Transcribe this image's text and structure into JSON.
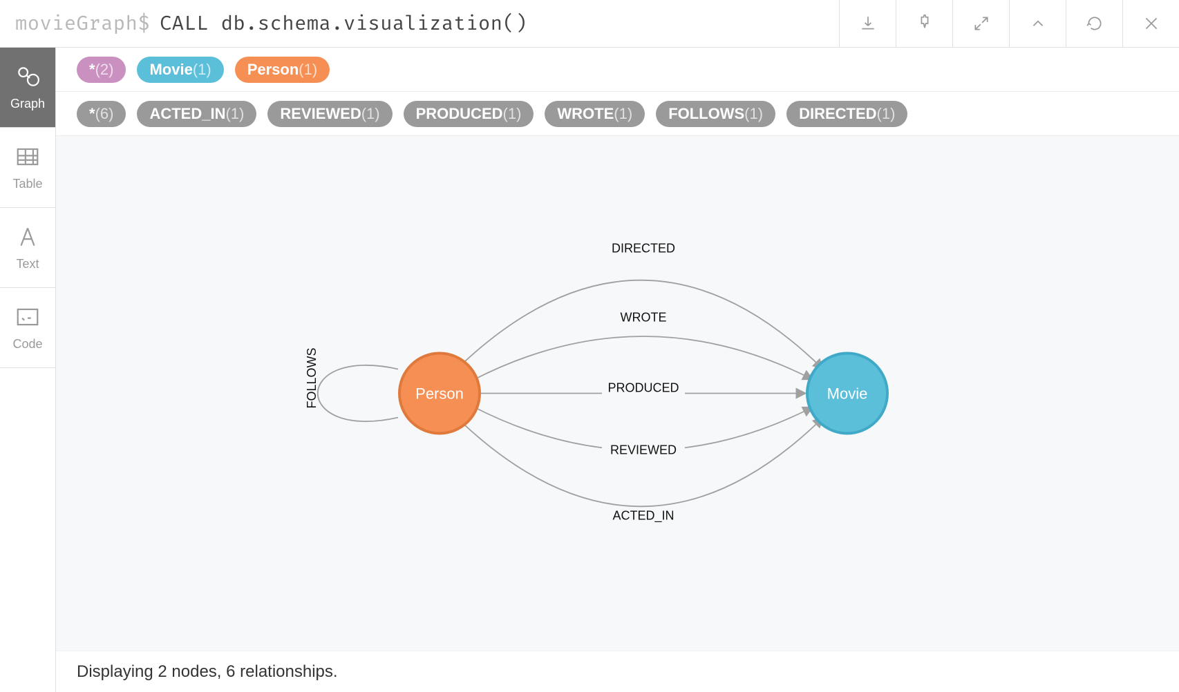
{
  "prompt": {
    "db": "movieGraph",
    "dollar": "$",
    "query": "CALL db.schema.visualization()"
  },
  "top_actions": [
    {
      "name": "download-icon"
    },
    {
      "name": "pin-icon"
    },
    {
      "name": "expand-icon"
    },
    {
      "name": "collapse-icon"
    },
    {
      "name": "rerun-icon"
    },
    {
      "name": "close-icon"
    }
  ],
  "sidebar": {
    "tabs": [
      {
        "name": "graph-tab",
        "label": "Graph",
        "active": true
      },
      {
        "name": "table-tab",
        "label": "Table",
        "active": false
      },
      {
        "name": "text-tab",
        "label": "Text",
        "active": false
      },
      {
        "name": "code-tab",
        "label": "Code",
        "active": false
      }
    ]
  },
  "labels_row": [
    {
      "text": "*",
      "count": "(2)",
      "color": "purple"
    },
    {
      "text": "Movie",
      "count": "(1)",
      "color": "blue"
    },
    {
      "text": "Person",
      "count": "(1)",
      "color": "orange"
    }
  ],
  "rels_row": [
    {
      "text": "*",
      "count": "(6)",
      "color": "grey"
    },
    {
      "text": "ACTED_IN",
      "count": "(1)",
      "color": "grey"
    },
    {
      "text": "REVIEWED",
      "count": "(1)",
      "color": "grey"
    },
    {
      "text": "PRODUCED",
      "count": "(1)",
      "color": "grey"
    },
    {
      "text": "WROTE",
      "count": "(1)",
      "color": "grey"
    },
    {
      "text": "FOLLOWS",
      "count": "(1)",
      "color": "grey"
    },
    {
      "text": "DIRECTED",
      "count": "(1)",
      "color": "grey"
    }
  ],
  "graph": {
    "nodes": [
      {
        "id": "person",
        "label": "Person",
        "color": "#f58f53",
        "stroke": "#e07a3c"
      },
      {
        "id": "movie",
        "label": "Movie",
        "color": "#5bbfd9",
        "stroke": "#3fa9c7"
      }
    ],
    "edges": [
      {
        "label": "DIRECTED"
      },
      {
        "label": "WROTE"
      },
      {
        "label": "PRODUCED"
      },
      {
        "label": "REVIEWED"
      },
      {
        "label": "ACTED_IN"
      },
      {
        "label": "FOLLOWS",
        "self": true
      }
    ]
  },
  "footer": "Displaying 2 nodes, 6 relationships."
}
